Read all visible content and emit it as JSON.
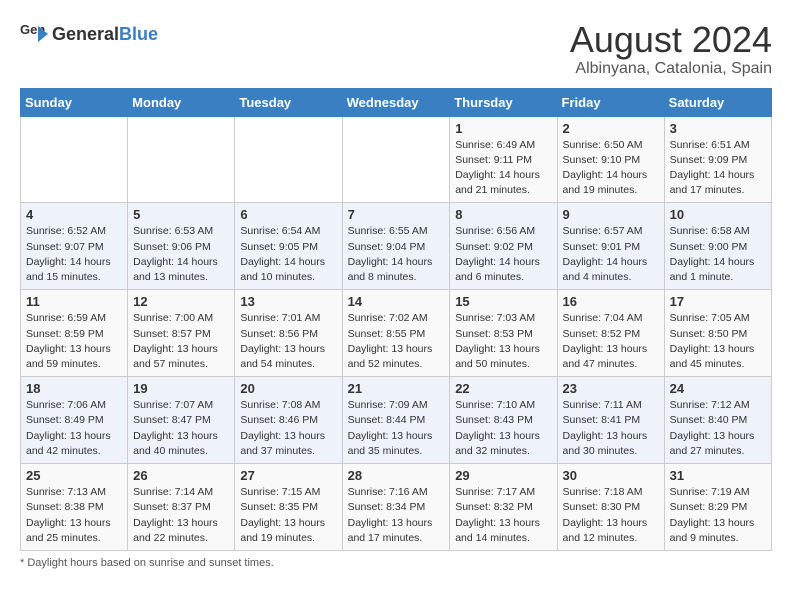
{
  "header": {
    "logo_general": "General",
    "logo_blue": "Blue",
    "title": "August 2024",
    "subtitle": "Albinyana, Catalonia, Spain"
  },
  "days_of_week": [
    "Sunday",
    "Monday",
    "Tuesday",
    "Wednesday",
    "Thursday",
    "Friday",
    "Saturday"
  ],
  "weeks": [
    [
      {
        "day": "",
        "info": ""
      },
      {
        "day": "",
        "info": ""
      },
      {
        "day": "",
        "info": ""
      },
      {
        "day": "",
        "info": ""
      },
      {
        "day": "1",
        "info": "Sunrise: 6:49 AM\nSunset: 9:11 PM\nDaylight: 14 hours and 21 minutes."
      },
      {
        "day": "2",
        "info": "Sunrise: 6:50 AM\nSunset: 9:10 PM\nDaylight: 14 hours and 19 minutes."
      },
      {
        "day": "3",
        "info": "Sunrise: 6:51 AM\nSunset: 9:09 PM\nDaylight: 14 hours and 17 minutes."
      }
    ],
    [
      {
        "day": "4",
        "info": "Sunrise: 6:52 AM\nSunset: 9:07 PM\nDaylight: 14 hours and 15 minutes."
      },
      {
        "day": "5",
        "info": "Sunrise: 6:53 AM\nSunset: 9:06 PM\nDaylight: 14 hours and 13 minutes."
      },
      {
        "day": "6",
        "info": "Sunrise: 6:54 AM\nSunset: 9:05 PM\nDaylight: 14 hours and 10 minutes."
      },
      {
        "day": "7",
        "info": "Sunrise: 6:55 AM\nSunset: 9:04 PM\nDaylight: 14 hours and 8 minutes."
      },
      {
        "day": "8",
        "info": "Sunrise: 6:56 AM\nSunset: 9:02 PM\nDaylight: 14 hours and 6 minutes."
      },
      {
        "day": "9",
        "info": "Sunrise: 6:57 AM\nSunset: 9:01 PM\nDaylight: 14 hours and 4 minutes."
      },
      {
        "day": "10",
        "info": "Sunrise: 6:58 AM\nSunset: 9:00 PM\nDaylight: 14 hours and 1 minute."
      }
    ],
    [
      {
        "day": "11",
        "info": "Sunrise: 6:59 AM\nSunset: 8:59 PM\nDaylight: 13 hours and 59 minutes."
      },
      {
        "day": "12",
        "info": "Sunrise: 7:00 AM\nSunset: 8:57 PM\nDaylight: 13 hours and 57 minutes."
      },
      {
        "day": "13",
        "info": "Sunrise: 7:01 AM\nSunset: 8:56 PM\nDaylight: 13 hours and 54 minutes."
      },
      {
        "day": "14",
        "info": "Sunrise: 7:02 AM\nSunset: 8:55 PM\nDaylight: 13 hours and 52 minutes."
      },
      {
        "day": "15",
        "info": "Sunrise: 7:03 AM\nSunset: 8:53 PM\nDaylight: 13 hours and 50 minutes."
      },
      {
        "day": "16",
        "info": "Sunrise: 7:04 AM\nSunset: 8:52 PM\nDaylight: 13 hours and 47 minutes."
      },
      {
        "day": "17",
        "info": "Sunrise: 7:05 AM\nSunset: 8:50 PM\nDaylight: 13 hours and 45 minutes."
      }
    ],
    [
      {
        "day": "18",
        "info": "Sunrise: 7:06 AM\nSunset: 8:49 PM\nDaylight: 13 hours and 42 minutes."
      },
      {
        "day": "19",
        "info": "Sunrise: 7:07 AM\nSunset: 8:47 PM\nDaylight: 13 hours and 40 minutes."
      },
      {
        "day": "20",
        "info": "Sunrise: 7:08 AM\nSunset: 8:46 PM\nDaylight: 13 hours and 37 minutes."
      },
      {
        "day": "21",
        "info": "Sunrise: 7:09 AM\nSunset: 8:44 PM\nDaylight: 13 hours and 35 minutes."
      },
      {
        "day": "22",
        "info": "Sunrise: 7:10 AM\nSunset: 8:43 PM\nDaylight: 13 hours and 32 minutes."
      },
      {
        "day": "23",
        "info": "Sunrise: 7:11 AM\nSunset: 8:41 PM\nDaylight: 13 hours and 30 minutes."
      },
      {
        "day": "24",
        "info": "Sunrise: 7:12 AM\nSunset: 8:40 PM\nDaylight: 13 hours and 27 minutes."
      }
    ],
    [
      {
        "day": "25",
        "info": "Sunrise: 7:13 AM\nSunset: 8:38 PM\nDaylight: 13 hours and 25 minutes."
      },
      {
        "day": "26",
        "info": "Sunrise: 7:14 AM\nSunset: 8:37 PM\nDaylight: 13 hours and 22 minutes."
      },
      {
        "day": "27",
        "info": "Sunrise: 7:15 AM\nSunset: 8:35 PM\nDaylight: 13 hours and 19 minutes."
      },
      {
        "day": "28",
        "info": "Sunrise: 7:16 AM\nSunset: 8:34 PM\nDaylight: 13 hours and 17 minutes."
      },
      {
        "day": "29",
        "info": "Sunrise: 7:17 AM\nSunset: 8:32 PM\nDaylight: 13 hours and 14 minutes."
      },
      {
        "day": "30",
        "info": "Sunrise: 7:18 AM\nSunset: 8:30 PM\nDaylight: 13 hours and 12 minutes."
      },
      {
        "day": "31",
        "info": "Sunrise: 7:19 AM\nSunset: 8:29 PM\nDaylight: 13 hours and 9 minutes."
      }
    ]
  ],
  "footer": "Daylight hours"
}
